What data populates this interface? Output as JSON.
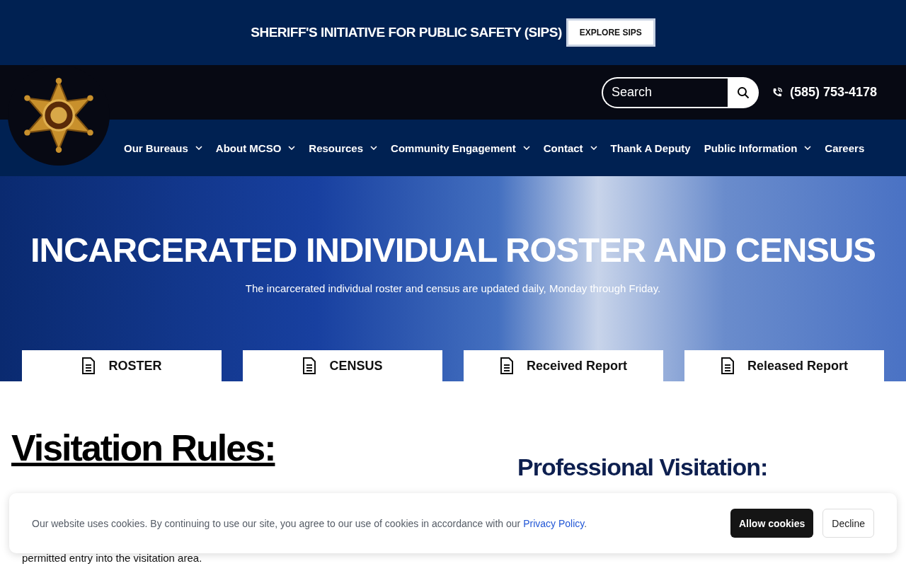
{
  "promo_bar": {
    "text": "SHERIFF'S INITIATIVE FOR PUBLIC SAFETY (SIPS)",
    "button": "EXPLORE SIPS"
  },
  "header": {
    "search": {
      "placeholder": "Search"
    },
    "phone": "(585) 753-4178"
  },
  "nav": [
    {
      "label": "Our Bureaus",
      "dropdown": true
    },
    {
      "label": "About MCSO",
      "dropdown": true
    },
    {
      "label": "Resources",
      "dropdown": true
    },
    {
      "label": "Community Engagement",
      "dropdown": true
    },
    {
      "label": "Contact",
      "dropdown": true
    },
    {
      "label": "Thank A Deputy",
      "dropdown": false
    },
    {
      "label": "Public Information",
      "dropdown": true
    },
    {
      "label": "Careers",
      "dropdown": false
    }
  ],
  "hero": {
    "title": "INCARCERATED INDIVIDUAL ROSTER AND CENSUS",
    "subtitle": "The incarcerated individual roster and census are updated daily, Monday through Friday."
  },
  "report_tabs": [
    {
      "label": "ROSTER"
    },
    {
      "label": "CENSUS"
    },
    {
      "label": "Received Report"
    },
    {
      "label": "Released Report"
    }
  ],
  "content": {
    "left_heading": "Visitation Rules:",
    "left_text": "permitted entry into the visitation area.",
    "right_headings": [
      "Professional Visitation:"
    ]
  },
  "cookie_banner": {
    "text": "Our website uses cookies. By continuing to use our site, you agree to our use of cookies in accordance with our",
    "link": "Privacy Policy",
    "after_link": ".",
    "buttons": [
      {
        "label": "Allow cookies",
        "kind": "primary"
      },
      {
        "label": "Decline",
        "kind": "secondary"
      }
    ]
  }
}
